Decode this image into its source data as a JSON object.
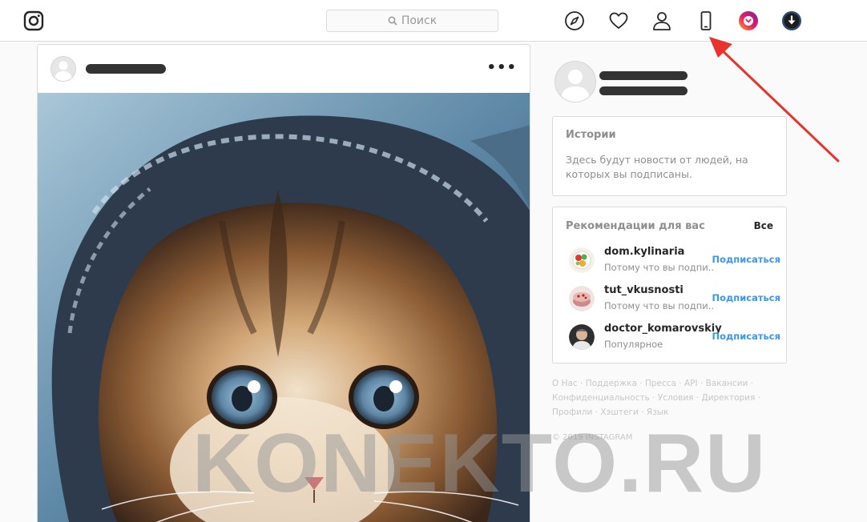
{
  "header": {
    "search_placeholder": "Поиск",
    "icons": [
      "instagram-logo-icon",
      "compass-icon",
      "heart-icon",
      "profile-icon",
      "mobile-phone-icon",
      "camera-gradient-icon",
      "download-icon"
    ]
  },
  "post": {
    "more_label": "•••",
    "photo_subject": "kitten"
  },
  "stories": {
    "title": "Истории",
    "text": "Здесь будут новости от людей, на которых вы подписаны."
  },
  "recommendations": {
    "title": "Рекомендации для вас",
    "all_label": "Все",
    "items": [
      {
        "name": "dom.kylinaria",
        "subtitle": "Потому что вы подпи...",
        "follow": "Подписаться"
      },
      {
        "name": "tut_vkusnosti",
        "subtitle": "Потому что вы подпи...",
        "follow": "Подписаться"
      },
      {
        "name": "doctor_komarovskiy",
        "subtitle": "Популярное",
        "follow": "Подписаться"
      }
    ]
  },
  "footer": {
    "links": [
      "О Нас",
      "Поддержка",
      "Пресса",
      "API",
      "Вакансии",
      "Конфиденциальность",
      "Условия",
      "Директория",
      "Профили",
      "Хэштеги",
      "Язык"
    ],
    "copyright": "© 2019 INSTAGRAM"
  },
  "watermark": "KONEKTO.RU",
  "colors": {
    "link_blue": "#3897f0",
    "border": "#dbdbdb",
    "arrow_red": "#e8322b"
  }
}
